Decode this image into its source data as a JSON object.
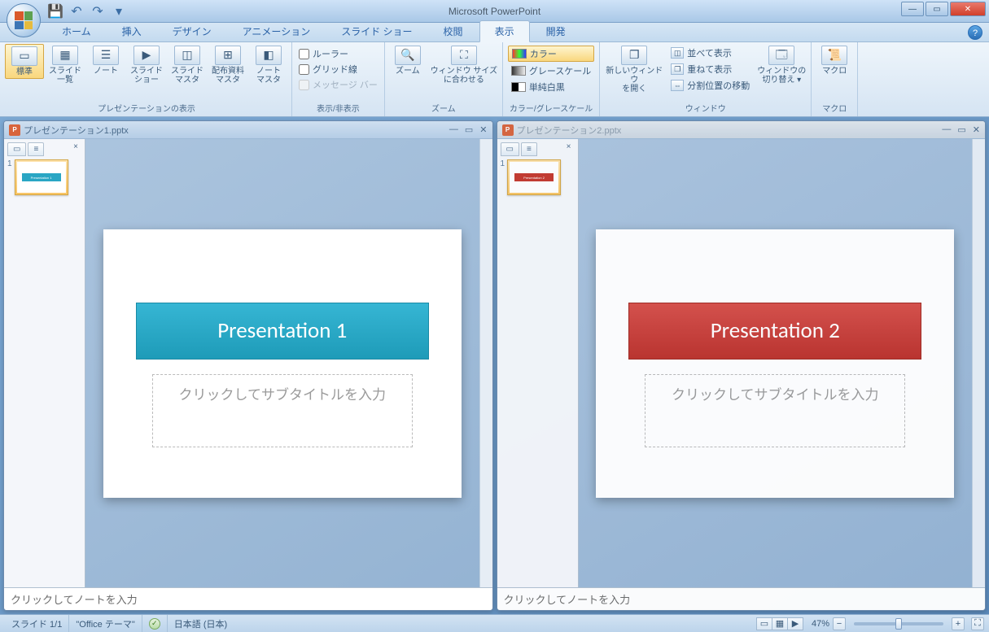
{
  "app": {
    "title": "Microsoft PowerPoint"
  },
  "qat": {
    "save": "💾",
    "undo": "↶",
    "redo": "↷"
  },
  "tabs": {
    "home": "ホーム",
    "insert": "挿入",
    "design": "デザイン",
    "animation": "アニメーション",
    "slideshow": "スライド ショー",
    "review": "校閲",
    "view": "表示",
    "developer": "開発"
  },
  "ribbon": {
    "grp_views_title": "プレゼンテーションの表示",
    "v_normal": "標準",
    "v_sorter": "スライド\n一覧",
    "v_notes": "ノート",
    "v_show": "スライド\nショー",
    "v_smaster": "スライド\nマスタ",
    "v_hmaster": "配布資料\nマスタ",
    "v_nmaster": "ノート\nマスタ",
    "grp_show_title": "表示/非表示",
    "chk_ruler": "ルーラー",
    "chk_grid": "グリッド線",
    "chk_msgbar": "メッセージ バー",
    "grp_zoom_title": "ズーム",
    "btn_zoom": "ズーム",
    "btn_fit": "ウィンドウ サイズ\nに合わせる",
    "grp_color_title": "カラー/グレースケール",
    "opt_color": "カラー",
    "opt_gray": "グレースケール",
    "opt_bw": "単純白黒",
    "grp_window_title": "ウィンドウ",
    "btn_newwin": "新しいウィンドウ\nを開く",
    "btn_arrange": "並べて表示",
    "btn_cascade": "重ねて表示",
    "btn_split": "分割位置の移動",
    "btn_switch": "ウィンドウの\n切り替え ▾",
    "grp_macro_title": "マクロ",
    "btn_macro": "マクロ"
  },
  "docs": {
    "d1_title": "プレゼンテーション1.pptx",
    "d2_title": "プレゼンテーション2.pptx",
    "p1_title": "Presentation 1",
    "p2_title": "Presentation 2",
    "subtitle_placeholder": "クリックしてサブタイトルを入力",
    "notes_placeholder": "クリックしてノートを入力"
  },
  "status": {
    "slide": "スライド 1/1",
    "theme": "\"Office テーマ\"",
    "lang": "日本語 (日本)",
    "zoom": "47%"
  }
}
